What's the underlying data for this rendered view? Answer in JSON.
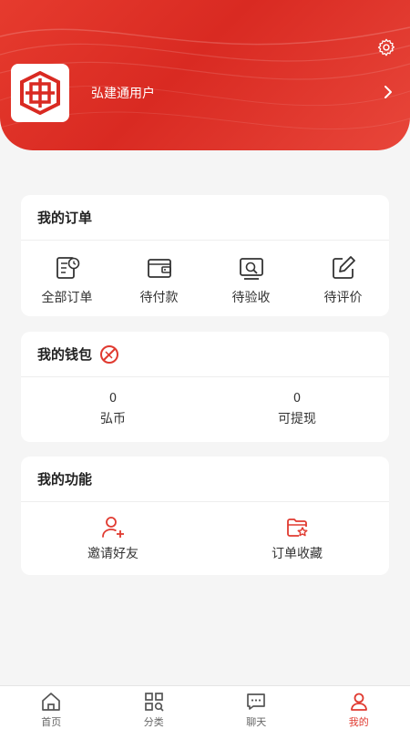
{
  "colors": {
    "brand": "#d92a22",
    "accent": "#e03a30",
    "text": "#333333",
    "background": "#f5f5f5"
  },
  "header": {
    "username": "弘建通用户",
    "settings_icon": "gear-icon",
    "arrow_icon": "chevron-right-icon"
  },
  "orders": {
    "title": "我的订单",
    "items": [
      {
        "label": "全部订单",
        "icon": "order-list-icon"
      },
      {
        "label": "待付款",
        "icon": "wallet-icon"
      },
      {
        "label": "待验收",
        "icon": "inspect-icon"
      },
      {
        "label": "待评价",
        "icon": "edit-icon"
      }
    ]
  },
  "wallet": {
    "title": "我的钱包",
    "badge_icon": "coin-badge-icon",
    "items": [
      {
        "value": "0",
        "label": "弘币"
      },
      {
        "value": "0",
        "label": "可提现"
      }
    ]
  },
  "functions": {
    "title": "我的功能",
    "items": [
      {
        "label": "邀请好友",
        "icon": "add-user-icon"
      },
      {
        "label": "订单收藏",
        "icon": "favorite-order-icon"
      }
    ]
  },
  "tabbar": {
    "items": [
      {
        "label": "首页",
        "icon": "home-icon"
      },
      {
        "label": "分类",
        "icon": "category-icon"
      },
      {
        "label": "聊天",
        "icon": "chat-icon"
      },
      {
        "label": "我的",
        "icon": "user-icon",
        "active": true
      }
    ]
  }
}
